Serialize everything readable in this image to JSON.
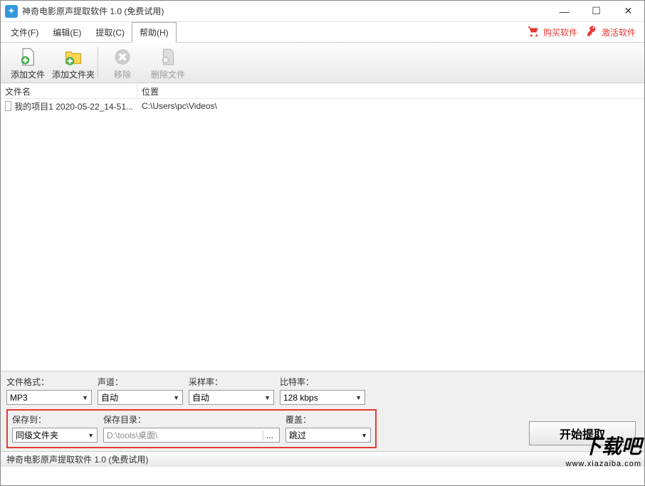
{
  "title": "神奇电影原声提取软件 1.0 (免费试用)",
  "menu": {
    "file": "文件(F)",
    "edit": "编辑(E)",
    "extract": "提取(C)",
    "help": "帮助(H)",
    "buy": "购买软件",
    "activate": "激活软件"
  },
  "toolbar": {
    "add_file": "添加文件",
    "add_folder": "添加文件夹",
    "remove": "移除",
    "delete_file": "删除文件"
  },
  "list": {
    "header_name": "文件名",
    "header_location": "位置",
    "rows": [
      {
        "name": "我的项目1 2020-05-22_14-51...",
        "location": "C:\\Users\\pc\\Videos\\"
      }
    ]
  },
  "settings": {
    "format_label": "文件格式：",
    "format_value": "MP3",
    "channel_label": "声道：",
    "channel_value": "自动",
    "sample_label": "采样率：",
    "sample_value": "自动",
    "bitrate_label": "比特率：",
    "bitrate_value": "128 kbps",
    "saveto_label": "保存到：",
    "saveto_value": "同级文件夹",
    "savedir_label": "保存目录：",
    "savedir_value": "D:\\tools\\桌面\\",
    "savedir_browse": "...",
    "overwrite_label": "覆盖：",
    "overwrite_value": "跳过",
    "start_button": "开始提取"
  },
  "statusbar": "神奇电影原声提取软件 1.0 (免费试用)",
  "watermark": {
    "big": "下载吧",
    "small": "www.xiazaiba.com"
  }
}
